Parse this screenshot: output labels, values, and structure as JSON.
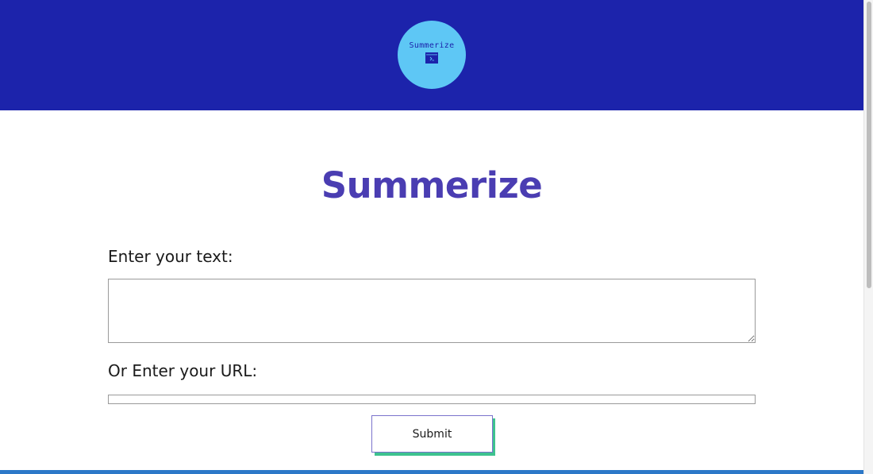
{
  "header": {
    "logo_text": "Summerize",
    "logo_icon": "terminal-window-icon",
    "background_color": "#1c23ab",
    "logo_color": "#5ec7f5"
  },
  "main": {
    "title": "Summerize",
    "title_color": "#4a3db2",
    "text_label": "Enter your text:",
    "text_value": "",
    "url_label": "Or Enter your URL:",
    "url_value": "",
    "submit_label": "Submit",
    "submit_shadow_color": "#3ec28f"
  }
}
